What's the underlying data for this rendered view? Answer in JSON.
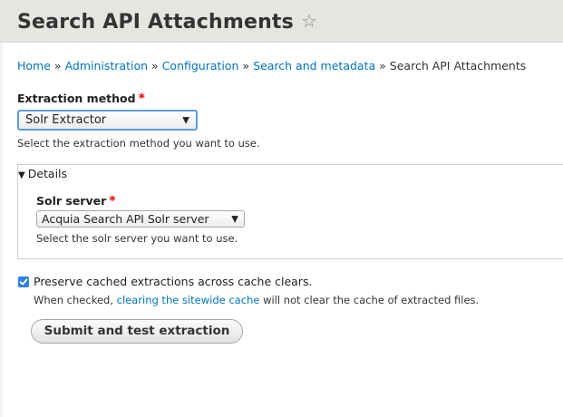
{
  "header": {
    "title": "Search API Attachments",
    "star_icon": "☆"
  },
  "breadcrumb": {
    "items": [
      "Home",
      "Administration",
      "Configuration",
      "Search and metadata"
    ],
    "current": "Search API Attachments",
    "separator": "»"
  },
  "extraction_method": {
    "label": "Extraction method",
    "required_marker": "*",
    "selected": "Solr Extractor",
    "description": "Select the extraction method you want to use."
  },
  "details": {
    "summary": "Details",
    "toggle_icon": "▼",
    "solr_server": {
      "label": "Solr server",
      "required_marker": "*",
      "selected": "Acquia Search API Solr server",
      "description": "Select the solr server you want to use."
    }
  },
  "preserve_cache": {
    "label": "Preserve cached extractions across cache clears.",
    "checked": true,
    "description_prefix": "When checked, ",
    "description_link": "clearing the sitewide cache",
    "description_suffix": " will not clear the cache of extracted files."
  },
  "submit_button": {
    "label": "Submit and test extraction"
  },
  "colors": {
    "link": "#0074bd",
    "required": "#ee0000",
    "checkbox": "#2f82e3",
    "header_bg": "#e6e5e1"
  }
}
